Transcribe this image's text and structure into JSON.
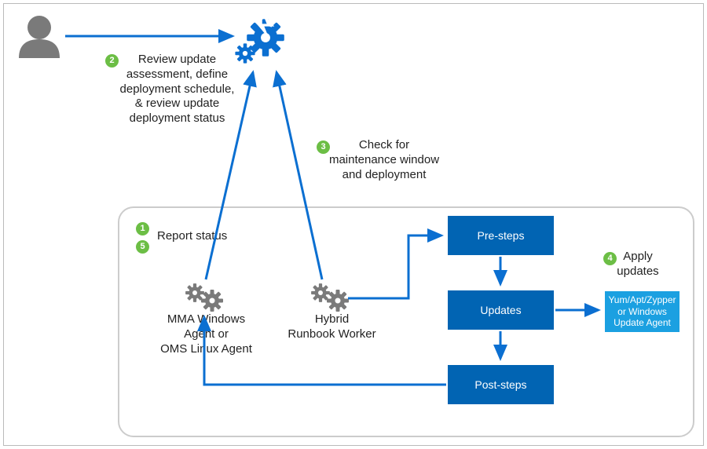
{
  "badges": {
    "b1": "1",
    "b2": "2",
    "b3": "3",
    "b4": "4",
    "b5": "5"
  },
  "labels": {
    "review": "Review update\nassessment, define\ndeployment schedule,\n& review update\ndeployment status",
    "check": "Check for\nmaintenance window\nand deployment",
    "report": "Report status",
    "apply": "Apply\nupdates",
    "mma": "MMA Windows\nAgent or\nOMS Linux Agent",
    "hybrid": "Hybrid\nRunbook Worker"
  },
  "boxes": {
    "pre": "Pre-steps",
    "updates": "Updates",
    "post": "Post-steps",
    "agent": "Yum/Apt/Zypper\nor Windows\nUpdate Agent"
  },
  "colors": {
    "blue": "#0b6fd1",
    "green": "#6cbe45",
    "dark": "#0164b3",
    "light": "#1ba0e1",
    "gray": "#7a7a7a"
  }
}
